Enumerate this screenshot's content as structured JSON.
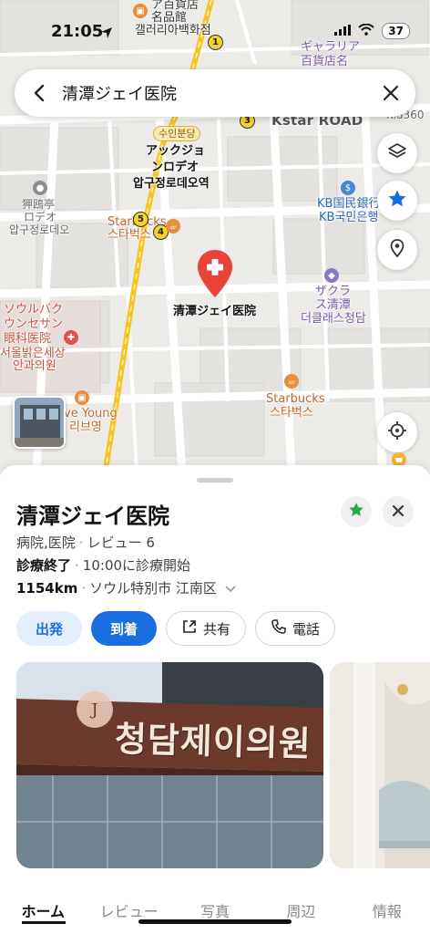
{
  "status": {
    "time": "21:05",
    "battery": "37"
  },
  "search": {
    "query": "清潭ジェイ医院"
  },
  "map": {
    "road_name": "Kstar ROAD",
    "labels": {
      "ahyun_store": "ア百貨店",
      "meihin": "名品館",
      "galleria_kr": "갤러리아백화점",
      "galleria_jp": "ギャラリア",
      "galleria_jp2": "百貨店名",
      "kia": "Kia360",
      "station_tag": "수인분당",
      "apgu_jp1": "アックジョ",
      "apgu_jp2": "ンロデオ",
      "apgu_kr": "압구정로데오역",
      "apgujeong_jp1": "狎鴎亭",
      "apgujeong_jp2": "ロデオ",
      "apgujeong_kr": "압구정로데오",
      "kb_jp": "KB国民銀行",
      "kb_kr": "KB국민은행",
      "starb1_jp": "Starbucks",
      "starb1_kr": "스타벅스",
      "clinic_pin": "清潭ジェイ医院",
      "clas_jp1": "ザクラ",
      "clas_jp2": "ス清潭",
      "clas_kr": "더클래스청담",
      "seoul_jp1": "ソウルバク",
      "seoul_jp2": "ウンセサン",
      "seoul_jp3": "眼科医院",
      "seoul_kr1": "서울밝은세상",
      "seoul_kr2": "안과의원",
      "starb2_jp": "Starbucks",
      "starb2_kr": "스타벅스",
      "oliveyoung_jp": "ve Young",
      "oliveyoung_kr": "리브영"
    },
    "metro_numbers": [
      "1",
      "3",
      "5",
      "4"
    ]
  },
  "place": {
    "title": "清潭ジェイ医院",
    "category": "病院,医院",
    "reviews": "レビュー 6",
    "status": "診療終了",
    "next_open": "10:00に診療開始",
    "distance": "1154km",
    "address": "ソウル特別市 江南区"
  },
  "actions": {
    "depart": "出発",
    "arrive": "到着",
    "share": "共有",
    "call": "電話"
  },
  "photo": {
    "sign_text": "청담제이의원"
  },
  "tabs": [
    "ホーム",
    "レビュー",
    "写真",
    "周辺",
    "情報"
  ],
  "colors": {
    "accent": "#1a6fe0",
    "pin": "#e9433a",
    "star": "#2aa84a"
  }
}
